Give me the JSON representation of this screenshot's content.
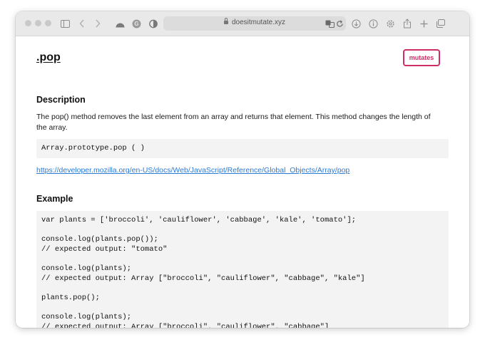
{
  "browser": {
    "url": "doesitmutate.xyz"
  },
  "page": {
    "title": ".pop",
    "badge": "mutates",
    "description_heading": "Description",
    "description": "The pop() method removes the last element from an array and returns that element. This method changes the length of the array.",
    "signature": "Array.prototype.pop ( )",
    "link": "https://developer.mozilla.org/en-US/docs/Web/JavaScript/Reference/Global_Objects/Array/pop",
    "example_heading": "Example",
    "code": "var plants = ['broccoli', 'cauliflower', 'cabbage', 'kale', 'tomato'];\n\nconsole.log(plants.pop());\n// expected output: \"tomato\"\n\nconsole.log(plants);\n// expected output: Array [\"broccoli\", \"cauliflower\", \"cabbage\", \"kale\"]\n\nplants.pop();\n\nconsole.log(plants);\n// expected output: Array [\"broccoli\", \"cauliflower\", \"cabbage\"]"
  },
  "colors": {
    "badge": "#cf2f63",
    "link": "#2a7ad6",
    "code_background": "#f3f3f3"
  },
  "icons": [
    "sidebar-icon",
    "back-icon",
    "forward-icon",
    "extension-icon",
    "grammarly-icon",
    "shield-icon",
    "lock-icon",
    "translate-icon",
    "reload-icon",
    "download-icon",
    "info-icon",
    "settings-icon",
    "share-icon",
    "new-tab-icon",
    "tab-overview-icon"
  ]
}
